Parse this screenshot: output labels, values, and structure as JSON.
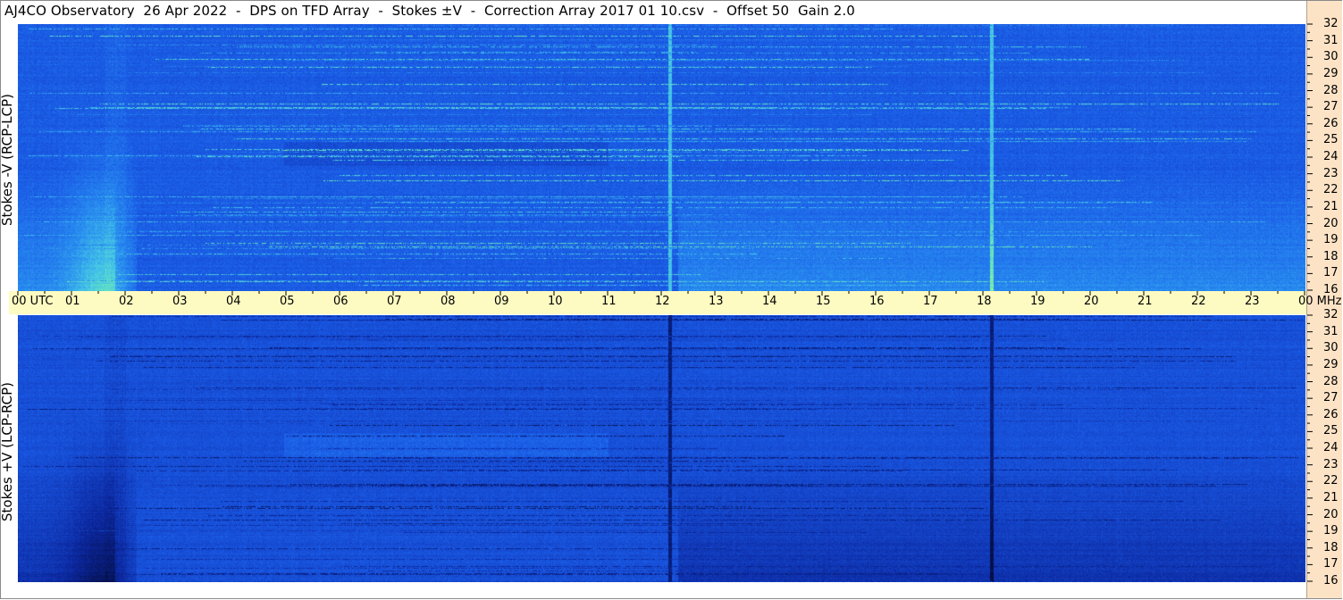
{
  "title": "AJ4CO Observatory  26 Apr 2022  -  DPS on TFD Array  -  Stokes ±V  -  Correction Array 2017 01 10.csv  -  Offset 50  Gain 2.0",
  "panels": {
    "top": {
      "ylabel": "Stokes -V (RCP-LCP)"
    },
    "bottom": {
      "ylabel": "Stokes +V (LCP-RCP)"
    }
  },
  "chart_data": {
    "type": "heatmap",
    "title": "AJ4CO Observatory  26 Apr 2022  -  DPS on TFD Array  -  Stokes ±V  -  Correction Array 2017 01 10.csv  -  Offset 50  Gain 2.0",
    "x_ticks": [
      "00",
      "01",
      "02",
      "03",
      "04",
      "05",
      "06",
      "07",
      "08",
      "09",
      "10",
      "11",
      "12",
      "13",
      "14",
      "15",
      "16",
      "17",
      "18",
      "19",
      "20",
      "21",
      "22",
      "23",
      "00"
    ],
    "x_range": [
      0,
      24
    ],
    "x_first_label": "00 UTC",
    "x_last_label": "00 MHz",
    "y_ticks": [
      16,
      17,
      18,
      19,
      20,
      21,
      22,
      23,
      24,
      25,
      26,
      27,
      28,
      29,
      30,
      31,
      32
    ],
    "y_range": [
      16,
      32
    ],
    "series": [
      {
        "name": "Stokes -V (RCP-LCP)"
      },
      {
        "name": "Stokes +V (LCP-RCP)"
      }
    ],
    "colors": {
      "base": "#1a5ae6",
      "low": "#0a1e7a",
      "high": "#60e6b0",
      "peak": "#f5f060",
      "utc_band": "#fdfbc2",
      "right_strip": "#fde3c6"
    },
    "grid": false
  }
}
